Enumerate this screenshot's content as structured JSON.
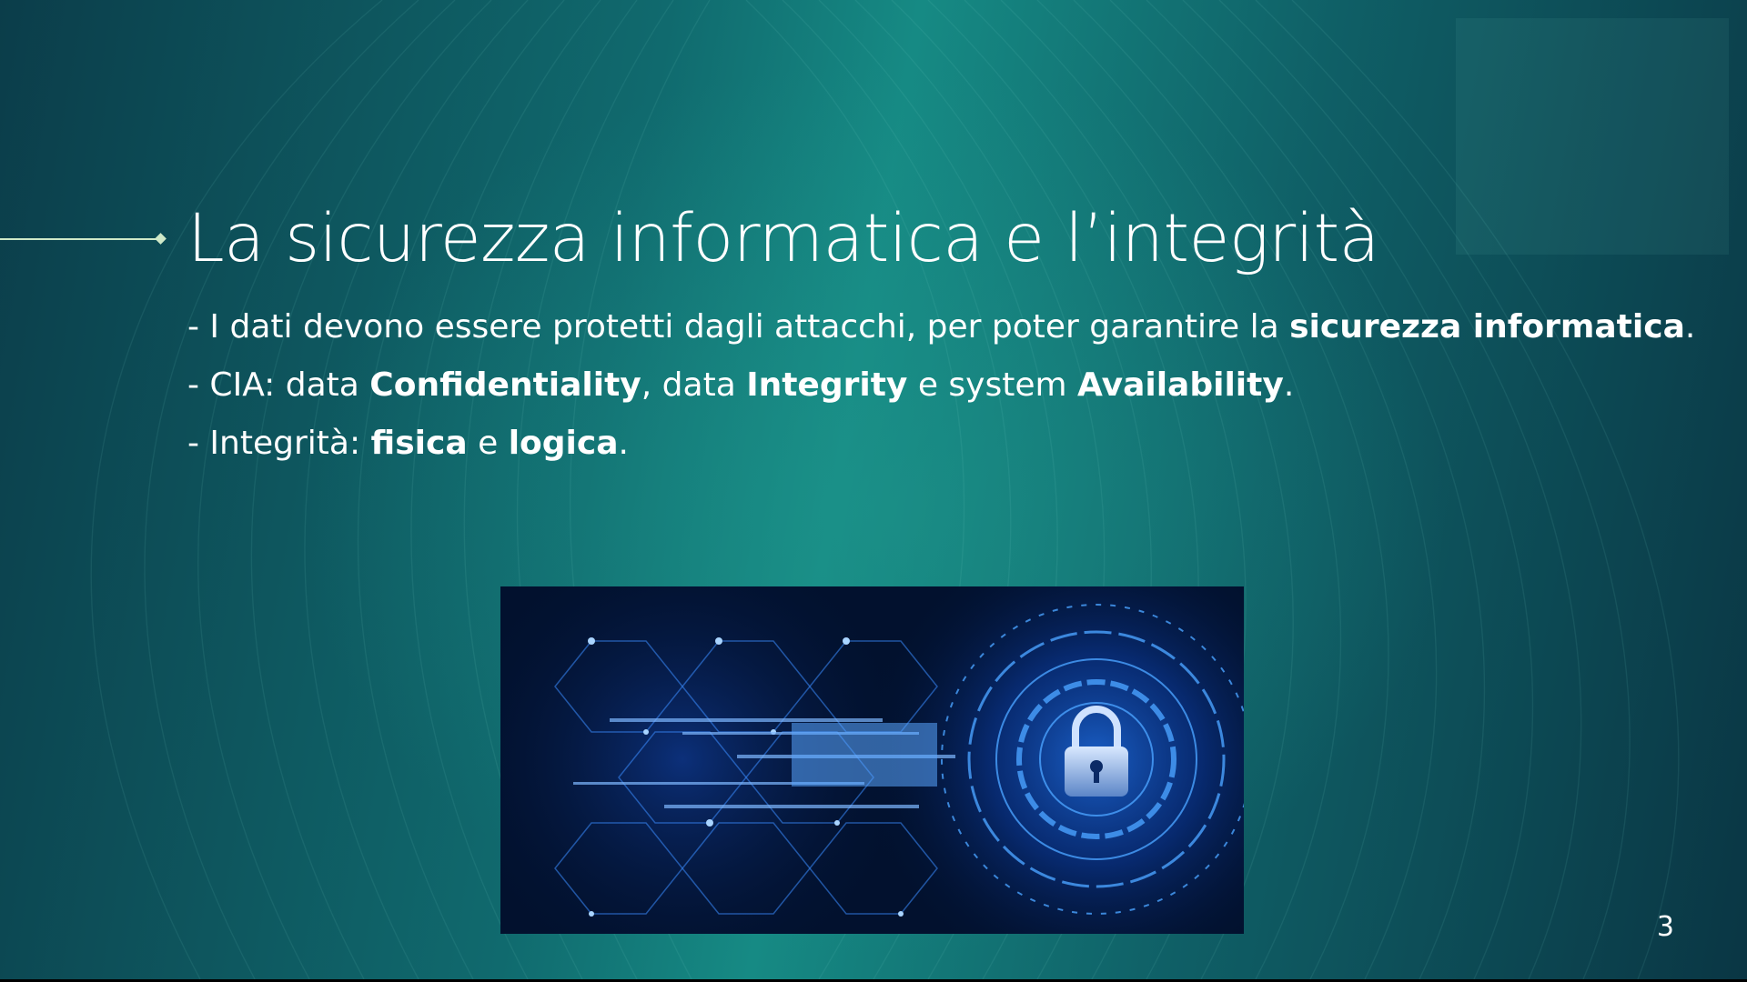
{
  "slide": {
    "title": "La sicurezza informatica e l’integrità",
    "bullets": [
      {
        "prefix": "- I dati devono essere protetti dagli attacchi, per poter garantire la ",
        "b1": "sicurezza informatica",
        "suffix": "."
      },
      {
        "prefix": "- CIA: data ",
        "b1": "Confidentiality",
        "m1": ", data ",
        "b2": "Integrity",
        "m2": " e system ",
        "b3": "Availability",
        "suffix": "."
      },
      {
        "prefix": "- Integrità: ",
        "b1": "fisica",
        "m1": " e ",
        "b2": "logica",
        "suffix": "."
      }
    ],
    "image_icon": "padlock-icon",
    "page_number": "3"
  },
  "colors": {
    "background_dark": "#0b3d4a",
    "background_light": "#168a84",
    "accent": "#cfe9c8",
    "text": "#ffffff",
    "image_glow": "#3aa0ff"
  }
}
